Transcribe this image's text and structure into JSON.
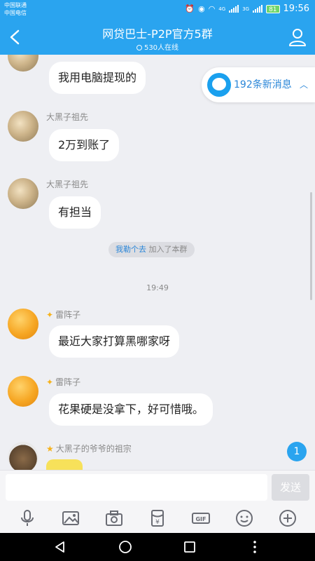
{
  "status_bar": {
    "carrier1": "中国联通",
    "carrier2": "中国电信",
    "network1": "4G",
    "network2": "3G",
    "battery": "81",
    "time": "19:56"
  },
  "header": {
    "title": "网贷巴士-P2P官方5群",
    "online": "530人在线"
  },
  "new_messages": {
    "label": "192条新消息"
  },
  "messages": [
    {
      "sender": "",
      "text": "我用电脑提现的"
    },
    {
      "sender": "大黑子祖先",
      "text": "2万到账了"
    },
    {
      "sender": "大黑子祖先",
      "text": "有担当"
    },
    {
      "sender": "雷阵子",
      "text": "最近大家打算黑哪家呀"
    },
    {
      "sender": "雷阵子",
      "text": "花果硬是没拿下，好可惜哦。"
    },
    {
      "sender": "大黑子的爷爷的祖宗",
      "text": ""
    }
  ],
  "system_note": {
    "user": "我勒个去",
    "action": "加入了本群"
  },
  "timestamp": "19:49",
  "unread_badge": "1",
  "input": {
    "placeholder": "",
    "send_label": "发送"
  },
  "toolbar": [
    "microphone-icon",
    "image-icon",
    "camera-icon",
    "red-packet-icon",
    "gif-icon",
    "emoji-icon",
    "plus-icon"
  ],
  "colors": {
    "header": "#2aa4ef",
    "background": "#eeeff3",
    "link": "#2a86d8",
    "star": "#f6b21b"
  }
}
